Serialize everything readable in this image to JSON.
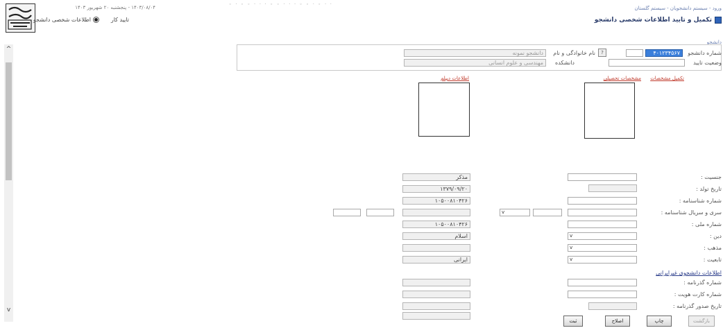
{
  "header": {
    "date_text": "۱۴۰۳/۰۸/۰۴ - پنجشنبه ۲۰ شهریور ۱۴۰۳",
    "nav_text": "ورود - سیستم دانشجویان - سیستم گلستان",
    "mode_text": "اطلاعات شخصی دانشجو",
    "mode_option": "تایید کار",
    "page_title": "تکمیل و تایید اطلاعات شخصی دانشجو",
    "top_dots": "◦ · ◦ ◦ ·    · · ◦ ◦ · · · ◦ ◦ · ◦ · ·"
  },
  "student": {
    "section_label": "دانشجو",
    "id_label": "شماره دانشجو",
    "id_value": "۴۰۱۲۳۴۵۶۷",
    "name_label": "نام خانوادگی و نام",
    "name_value": "دانشجو نمونه",
    "status_label": "وضعیت تایید",
    "faculty_label": "دانشکده",
    "faculty_value": "مهندسی و علوم انسانی"
  },
  "photos": {
    "right_link_1": "تکمیل مشخصات",
    "right_link_2": "مشخصات تحصیلی",
    "left_link": "اطلاعات دیپلم"
  },
  "form": {
    "rows": [
      {
        "label": "جنسیت :",
        "left_value": "مذکر"
      },
      {
        "label": "تاریخ تولد :",
        "left_value": "۱۳۷۹/۰۹/۲۰"
      },
      {
        "label": "شماره شناسنامه :",
        "left_value": "۱۰۵۰۰۸۱۰۴۲۶"
      },
      {
        "label": "سری و سریال شناسنامه :",
        "left_value": ""
      },
      {
        "label": "شماره ملی :",
        "left_value": "۱۰۵۰۰۸۱۰۴۲۶"
      },
      {
        "label": "دین :",
        "left_value": "اسلام"
      },
      {
        "label": "مذهب :",
        "left_value": ""
      },
      {
        "label": "تابعیت :",
        "left_value": "ایرانی"
      }
    ],
    "foreign_section": "اطلاعات دانشجوی غیرایرانی",
    "foreign_rows": [
      {
        "label": "شماره گذرنامه :"
      },
      {
        "label": "شماره کارت هویت :"
      },
      {
        "label": "تاریخ صدور گذرنامه :"
      }
    ]
  },
  "buttons": {
    "confirm": "ثبت",
    "edit": "اصلاح",
    "print": "چاپ",
    "back": "بازگشت"
  }
}
